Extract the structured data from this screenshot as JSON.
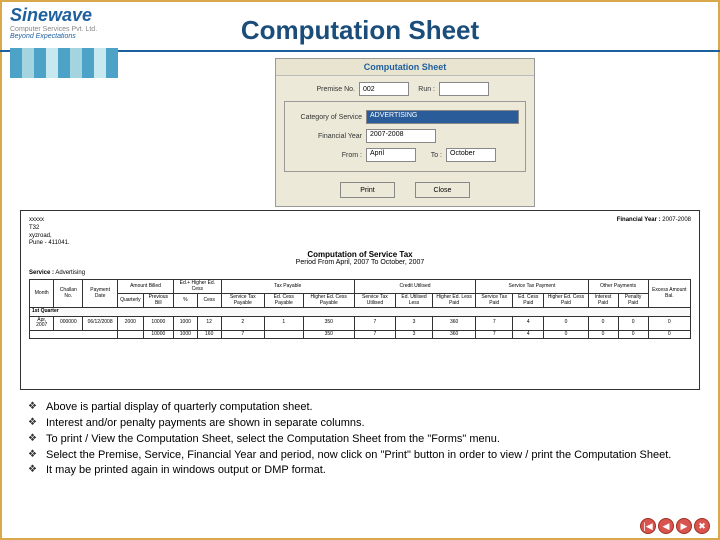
{
  "logo": {
    "brand": "Sinewave",
    "sub": "Computer Services Pvt. Ltd.",
    "tag": "Beyond Expectations"
  },
  "title": "Computation Sheet",
  "dialog": {
    "title": "Computation Sheet",
    "premise_label": "Premise No.",
    "premise_value": "002",
    "run_label": "Run :",
    "category_label": "Category of Service",
    "category_value": "ADVERTISING",
    "finyear_label": "Financial Year",
    "finyear_value": "2007-2008",
    "from_label": "From :",
    "from_value": "April",
    "to_label": "To :",
    "to_value": "October",
    "btn_print": "Print",
    "btn_close": "Close"
  },
  "report": {
    "addr": [
      "xxxxx",
      "T32",
      "xyzroad,",
      "Pune - 411041."
    ],
    "fy_label": "Financial Year :",
    "fy_value": "2007-2008",
    "h1": "Computation of Service Tax",
    "h2": "Period From  April, 2007  To  October, 2007",
    "service_label": "Service :",
    "service_value": "Advertising",
    "headers": {
      "month": "Month",
      "challan": "Challan No.",
      "paydate": "Payment Date",
      "billed_group": "Amount Billed",
      "billed_q": "Quarterly",
      "billed_prev": "Previous Bill",
      "hec_group": "Ed.+ Higher Ed. Cess",
      "hec_pct": "%",
      "hec_cess": "Cess",
      "payable_group": "Tax Payable",
      "pay_st": "Service Tax Payable",
      "pay_ed": "Ed. Cess Payable",
      "pay_hec": "Higher Ed. Cess Payable",
      "credit_group": "Credit Utilised",
      "cr_st": "Service Tax Utilised",
      "cr_ed": "Ed. Utilised Less",
      "cr_hec": "Higher Ed. Less Paid",
      "stp_group": "Service Tax Payment",
      "stp_st": "Service Tax Paid",
      "stp_ed": "Ed. Cess Paid",
      "stp_hec": "Higher Ed. Cess Paid",
      "other_group": "Other Payments",
      "oth_int": "Interest Paid",
      "oth_pen": "Penalty Paid",
      "excess": "Excess Amount Bal."
    },
    "group1": "1st Quarter",
    "row1": {
      "month": "Apr, 2007",
      "challan": "000000",
      "paydate": "06/12/2008",
      "billed_q": "2000",
      "billed_prev": "10000",
      "hec_pct": "1000",
      "hec_cess": "12",
      "pay_st": "2",
      "pay_ed": "1",
      "pay_hec": "350",
      "cr_st": "7",
      "cr_ed": "3",
      "cr_hec": "360",
      "stp_st": "7",
      "stp_ed": "4",
      "stp_hec": "0",
      "oth_int": "0",
      "oth_pen": "0",
      "excess": "0"
    },
    "tot": {
      "billed_q": "",
      "billed_prev": "10000",
      "hec_pct": "1000",
      "hec_cess": "160",
      "pay_st": "7",
      "pay_ed": "",
      "pay_hec": "350",
      "cr_st": "7",
      "cr_ed": "3",
      "cr_hec": "360",
      "stp_st": "7",
      "stp_ed": "4",
      "stp_hec": "0",
      "oth_int": "0",
      "oth_pen": "0",
      "excess": "0"
    }
  },
  "bullets": [
    "Above is partial display of quarterly computation sheet.",
    "Interest and/or penalty payments are shown in separate columns.",
    "To print / View the Computation Sheet, select the Computation Sheet from the \"Forms\" menu.",
    "Select the Premise, Service, Financial Year and period, now click on \"Print\" button in order to view / print the Computation Sheet.",
    "It may be printed again in windows output or DMP format."
  ],
  "nav": {
    "first": "|◀",
    "prev": "◀",
    "next": "▶",
    "close": "✖"
  }
}
